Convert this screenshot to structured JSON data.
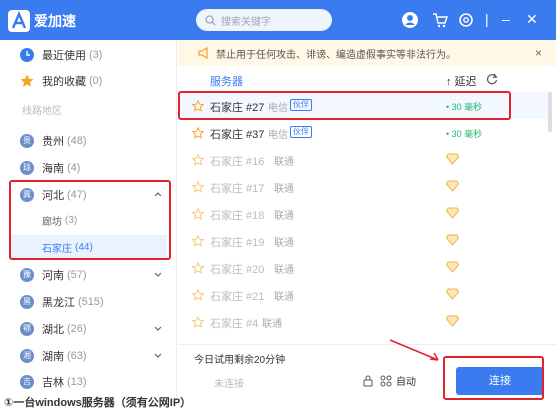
{
  "app": {
    "name": "爱加速"
  },
  "search": {
    "placeholder": "搜索关键字"
  },
  "sidebar": {
    "top_items": [
      {
        "label": "最近使用",
        "count": "(3)"
      },
      {
        "label": "我的收藏",
        "count": "(0)"
      }
    ],
    "section_title": "线路地区",
    "regions": [
      {
        "label": "贵州",
        "count": "(48)",
        "badge": "贵"
      },
      {
        "label": "海南",
        "count": "(4)",
        "badge": "琼"
      },
      {
        "label": "河北",
        "count": "(47)",
        "badge": "冀"
      },
      {
        "label": "河南",
        "count": "(57)",
        "badge": "豫"
      },
      {
        "label": "黑龙江",
        "count": "(515)",
        "badge": "黑"
      },
      {
        "label": "湖北",
        "count": "(26)",
        "badge": "鄂"
      },
      {
        "label": "湖南",
        "count": "(63)",
        "badge": "湘"
      },
      {
        "label": "吉林",
        "count": "(13)",
        "badge": "吉"
      }
    ],
    "hebei_children": [
      {
        "label": "廊坊",
        "count": "(3)"
      },
      {
        "label": "石家庄",
        "count": "(44)"
      }
    ]
  },
  "notice": {
    "text": "禁止用于任何攻击、诽谤、编造虚假事实等非法行为。",
    "close": "×"
  },
  "table": {
    "col_server": "服务器",
    "col_latency": "↑ 延迟",
    "rows": [
      {
        "name": "石家庄 #27",
        "line": "电信",
        "tag": "伙伴",
        "latency": "• 30 毫秒"
      },
      {
        "name": "石家庄 #37",
        "line": "电信",
        "tag": "伙伴",
        "latency": "• 30 毫秒"
      },
      {
        "name": "石家庄 #16",
        "line": "联通"
      },
      {
        "name": "石家庄 #17",
        "line": "联通"
      },
      {
        "name": "石家庄 #18",
        "line": "联通"
      },
      {
        "name": "石家庄 #19",
        "line": "联通"
      },
      {
        "name": "石家庄 #20",
        "line": "联通"
      },
      {
        "name": "石家庄 #21",
        "line": "联通"
      },
      {
        "name": "石家庄 #4",
        "line": "联通"
      }
    ]
  },
  "bottom": {
    "trial": "今日试用剩余20分钟",
    "status": "未连接",
    "mode": "自动",
    "connect": "连接"
  },
  "caption": "①一台windows服务器（须有公网IP）",
  "colors": {
    "brand": "#3a7bf0",
    "highlight": "#e3232b",
    "latency": "#1fb86a"
  }
}
